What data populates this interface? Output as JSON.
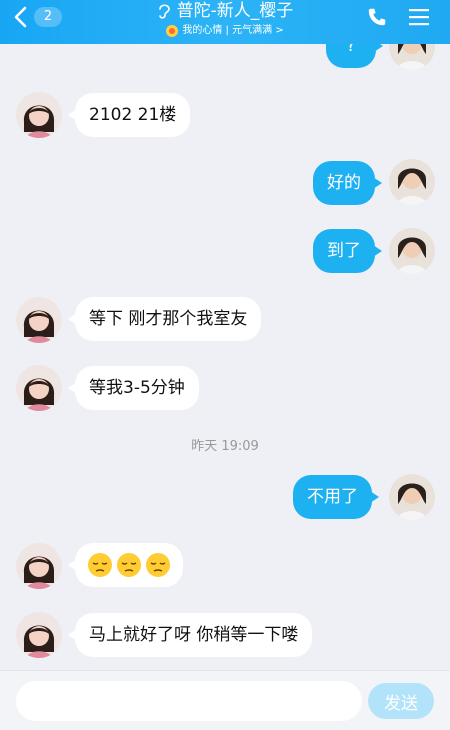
{
  "header": {
    "unread_count": "2",
    "title": "普陀-新人_樱子",
    "subtitle": "我的心情 | 元气满满 >",
    "accent_color": "#1ea9f2"
  },
  "messages": [
    {
      "side": "right",
      "text": "?"
    },
    {
      "side": "left",
      "text": "2102  21楼"
    },
    {
      "side": "right",
      "text": "好的"
    },
    {
      "side": "right",
      "text": "到了"
    },
    {
      "side": "left",
      "text": "等下  刚才那个我室友"
    },
    {
      "side": "left",
      "text": "等我3-5分钟"
    },
    {
      "side": "right",
      "text": "不用了"
    },
    {
      "side": "left",
      "emoji": "pensive-face",
      "count": 3
    },
    {
      "side": "left",
      "text": "马上就好了呀 你稍等一下喽"
    }
  ],
  "timestamp": "昨天 19:09",
  "composer": {
    "placeholder": "",
    "send_label": "发送"
  },
  "icons": [
    "back-chevron-icon",
    "hearing-ear-icon",
    "mood-icon",
    "phone-icon",
    "menu-icon",
    "pensive-face-emoji"
  ]
}
